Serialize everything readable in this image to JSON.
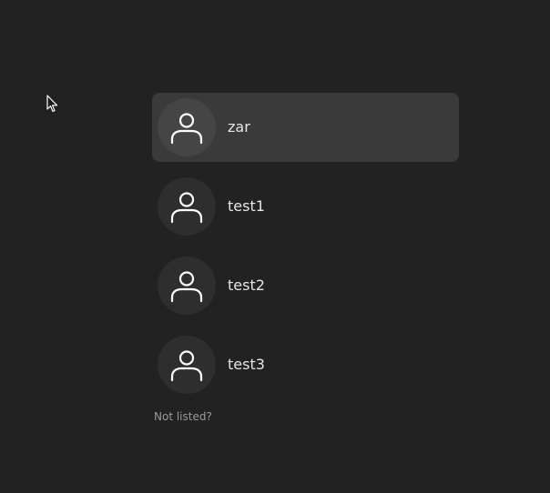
{
  "users": [
    {
      "name": "zar",
      "icon": "user-icon",
      "selected": true
    },
    {
      "name": "test1",
      "icon": "user-icon",
      "selected": false
    },
    {
      "name": "test2",
      "icon": "user-icon",
      "selected": false
    },
    {
      "name": "test3",
      "icon": "user-icon",
      "selected": false
    }
  ],
  "not_listed_label": "Not listed?",
  "colors": {
    "background": "#222222",
    "selected_row": "#3a3a3a",
    "avatar_bg": "#2e2e2e",
    "text": "#e6e6e6",
    "muted_text": "#9a9a9a"
  }
}
